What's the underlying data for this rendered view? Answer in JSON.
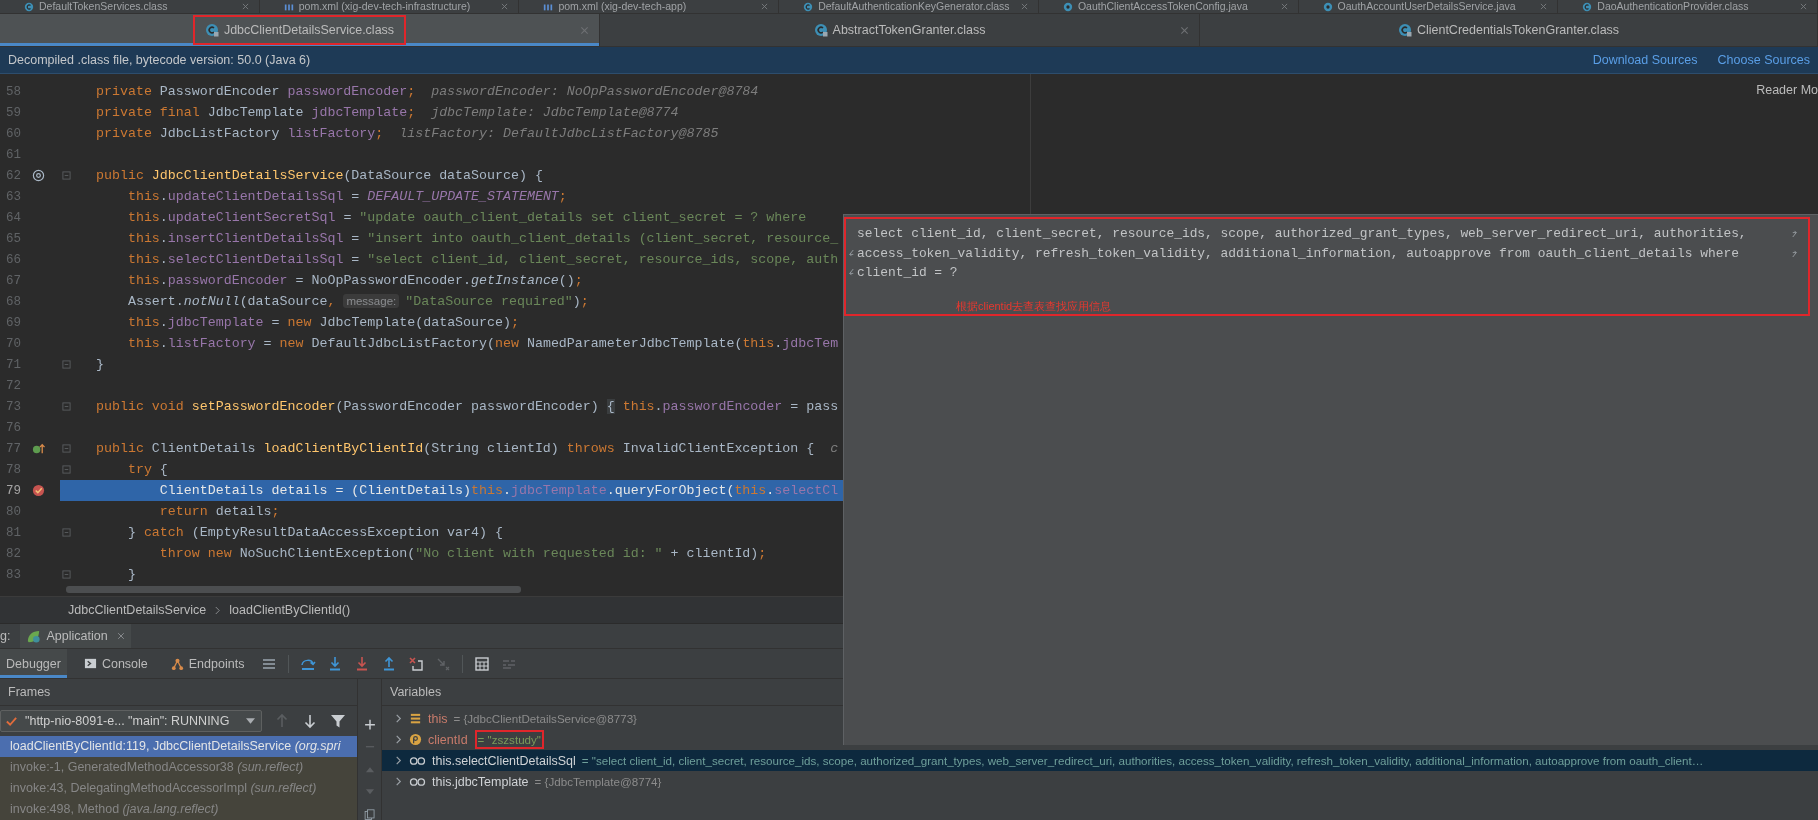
{
  "top_tabs": [
    {
      "label": "DefaultTokenServices.class",
      "kind": "class"
    },
    {
      "label": "pom.xml (xig-dev-tech-infrastructure)",
      "kind": "maven"
    },
    {
      "label": "pom.xml (xig-dev-tech-app)",
      "kind": "maven"
    },
    {
      "label": "DefaultAuthenticationKeyGenerator.class",
      "kind": "class"
    },
    {
      "label": "OauthClientAccessTokenConfig.java",
      "kind": "java"
    },
    {
      "label": "OauthAccountUserDetailsService.java",
      "kind": "java"
    },
    {
      "label": "DaoAuthenticationProvider.class",
      "kind": "class"
    }
  ],
  "editor_tabs": [
    {
      "label": "JdbcClientDetailsService.class",
      "kind": "class",
      "selected": true,
      "closable": true
    },
    {
      "label": "AbstractTokenGranter.class",
      "kind": "class",
      "selected": false,
      "closable": true
    },
    {
      "label": "ClientCredentialsTokenGranter.class",
      "kind": "class",
      "selected": false,
      "closable": false
    }
  ],
  "banner": {
    "message": "Decompiled .class file, bytecode version: 50.0 (Java 6)",
    "links": [
      "Download Sources",
      "Choose Sources"
    ]
  },
  "editor": {
    "reader_mode": "Reader Mo",
    "lines": [
      {
        "number": "58",
        "kind": "plain",
        "fold": false,
        "current": false,
        "tokens": [
          {
            "kind": "kw",
            "text": "private "
          },
          {
            "kind": "plain",
            "text": "PasswordEncoder "
          },
          {
            "kind": "field",
            "text": "passwordEncoder"
          },
          {
            "kind": "kw",
            "text": ";"
          },
          {
            "kind": "hint",
            "text": "  passwordEncoder: NoOpPasswordEncoder@8784"
          }
        ]
      },
      {
        "number": "59",
        "kind": "plain",
        "fold": false,
        "current": false,
        "tokens": [
          {
            "kind": "kw",
            "text": "private final "
          },
          {
            "kind": "plain",
            "text": "JdbcTemplate "
          },
          {
            "kind": "field",
            "text": "jdbcTemplate"
          },
          {
            "kind": "kw",
            "text": ";"
          },
          {
            "kind": "hint",
            "text": "  jdbcTemplate: JdbcTemplate@8774"
          }
        ]
      },
      {
        "number": "60",
        "kind": "plain",
        "fold": false,
        "current": false,
        "tokens": [
          {
            "kind": "kw",
            "text": "private "
          },
          {
            "kind": "plain",
            "text": "JdbcListFactory "
          },
          {
            "kind": "field",
            "text": "listFactory"
          },
          {
            "kind": "kw",
            "text": ";"
          },
          {
            "kind": "hint",
            "text": "  listFactory: DefaultJdbcListFactory@8785"
          }
        ]
      },
      {
        "number": "61",
        "kind": "plain",
        "fold": false,
        "current": false
      },
      {
        "number": "62",
        "kind": "at",
        "fold": true,
        "current": false,
        "tokens": [
          {
            "kind": "kw",
            "text": "public "
          },
          {
            "kind": "method",
            "text": "JdbcClientDetailsService"
          },
          {
            "kind": "plain",
            "text": "(DataSource dataSource) {"
          }
        ]
      },
      {
        "number": "63",
        "kind": "plain",
        "fold": false,
        "current": false,
        "tokens": [
          {
            "kind": "kw",
            "text": "    this"
          },
          {
            "kind": "plain",
            "text": "."
          },
          {
            "kind": "field",
            "text": "updateClientDetailsSql"
          },
          {
            "kind": "plain",
            "text": " = "
          },
          {
            "kind": "static",
            "text": "DEFAULT_UPDATE_STATEMENT"
          },
          {
            "kind": "kw",
            "text": ";"
          }
        ]
      },
      {
        "number": "64",
        "kind": "plain",
        "fold": false,
        "current": false,
        "tokens": [
          {
            "kind": "kw",
            "text": "    this"
          },
          {
            "kind": "plain",
            "text": "."
          },
          {
            "kind": "field",
            "text": "updateClientSecretSql"
          },
          {
            "kind": "plain",
            "text": " = "
          },
          {
            "kind": "str",
            "text": "\"update oauth_client_details set client_secret = ? where"
          }
        ]
      },
      {
        "number": "65",
        "kind": "plain",
        "fold": false,
        "current": false,
        "tokens": [
          {
            "kind": "kw",
            "text": "    this"
          },
          {
            "kind": "plain",
            "text": "."
          },
          {
            "kind": "field",
            "text": "insertClientDetailsSql"
          },
          {
            "kind": "plain",
            "text": " = "
          },
          {
            "kind": "str",
            "text": "\"insert into oauth_client_details (client_secret, resource_"
          }
        ]
      },
      {
        "number": "66",
        "kind": "plain",
        "fold": false,
        "current": false,
        "tokens": [
          {
            "kind": "kw",
            "text": "    this"
          },
          {
            "kind": "plain",
            "text": "."
          },
          {
            "kind": "field",
            "text": "selectClientDetailsSql"
          },
          {
            "kind": "plain",
            "text": " = "
          },
          {
            "kind": "str",
            "text": "\"select client_id, client_secret, resource_ids, scope, auth"
          }
        ]
      },
      {
        "number": "67",
        "kind": "plain",
        "fold": false,
        "current": false,
        "tokens": [
          {
            "kind": "kw",
            "text": "    this"
          },
          {
            "kind": "plain",
            "text": "."
          },
          {
            "kind": "field",
            "text": "passwordEncoder"
          },
          {
            "kind": "plain",
            "text": " = NoOpPasswordEncoder."
          },
          {
            "kind": "call",
            "text": "getInstance"
          },
          {
            "kind": "plain",
            "text": "()"
          },
          {
            "kind": "kw",
            "text": ";"
          }
        ]
      },
      {
        "number": "68",
        "kind": "plain",
        "fold": false,
        "current": false,
        "tokens": [
          {
            "kind": "plain",
            "text": "    Assert."
          },
          {
            "kind": "call",
            "text": "notNull"
          },
          {
            "kind": "plain",
            "text": "(dataSource"
          },
          {
            "kind": "kw",
            "text": ", "
          },
          {
            "kind": "inlay",
            "text": "message:"
          },
          {
            "kind": "str",
            "text": "\"DataSource required\""
          },
          {
            "kind": "plain",
            "text": ")"
          },
          {
            "kind": "kw",
            "text": ";"
          }
        ]
      },
      {
        "number": "69",
        "kind": "plain",
        "fold": false,
        "current": false,
        "tokens": [
          {
            "kind": "kw",
            "text": "    this"
          },
          {
            "kind": "plain",
            "text": "."
          },
          {
            "kind": "field",
            "text": "jdbcTemplate"
          },
          {
            "kind": "plain",
            "text": " = "
          },
          {
            "kind": "kw",
            "text": "new "
          },
          {
            "kind": "plain",
            "text": "JdbcTemplate(dataSource)"
          },
          {
            "kind": "kw",
            "text": ";"
          }
        ]
      },
      {
        "number": "70",
        "kind": "plain",
        "fold": false,
        "current": false,
        "tokens": [
          {
            "kind": "kw",
            "text": "    this"
          },
          {
            "kind": "plain",
            "text": "."
          },
          {
            "kind": "field",
            "text": "listFactory"
          },
          {
            "kind": "plain",
            "text": " = "
          },
          {
            "kind": "kw",
            "text": "new "
          },
          {
            "kind": "plain",
            "text": "DefaultJdbcListFactory("
          },
          {
            "kind": "kw",
            "text": "new "
          },
          {
            "kind": "plain",
            "text": "NamedParameterJdbcTemplate("
          },
          {
            "kind": "kw",
            "text": "this"
          },
          {
            "kind": "plain",
            "text": "."
          },
          {
            "kind": "field",
            "text": "jdbcTem"
          }
        ]
      },
      {
        "number": "71",
        "kind": "plain",
        "fold": true,
        "current": false,
        "tokens": [
          {
            "kind": "plain",
            "text": "}"
          }
        ]
      },
      {
        "number": "72",
        "kind": "plain",
        "fold": false,
        "current": false
      },
      {
        "number": "73",
        "kind": "plain",
        "fold": true,
        "current": false,
        "tokens": [
          {
            "kind": "kw",
            "text": "public void "
          },
          {
            "kind": "method",
            "text": "setPasswordEncoder"
          },
          {
            "kind": "plain",
            "text": "(PasswordEncoder passwordEncoder) "
          },
          {
            "kind": "folded",
            "text": "{"
          },
          {
            "kind": "kw",
            "text": " this"
          },
          {
            "kind": "plain",
            "text": "."
          },
          {
            "kind": "field",
            "text": "passwordEncoder"
          },
          {
            "kind": "plain",
            "text": " = pass"
          }
        ]
      },
      {
        "number": "76",
        "kind": "plain",
        "fold": false,
        "current": false
      },
      {
        "number": "77",
        "kind": "override",
        "fold": true,
        "current": false,
        "tokens": [
          {
            "kind": "kw",
            "text": "public "
          },
          {
            "kind": "plain",
            "text": "ClientDetails "
          },
          {
            "kind": "method",
            "text": "loadClientByClientId"
          },
          {
            "kind": "plain",
            "text": "(String clientId) "
          },
          {
            "kind": "kw",
            "text": "throws "
          },
          {
            "kind": "plain",
            "text": "InvalidClientException {  "
          },
          {
            "kind": "hint",
            "text": "c"
          }
        ]
      },
      {
        "number": "78",
        "kind": "plain",
        "fold": true,
        "current": false,
        "tokens": [
          {
            "kind": "kw",
            "text": "    try "
          },
          {
            "kind": "plain",
            "text": "{"
          }
        ]
      },
      {
        "number": "79",
        "kind": "breakpoint",
        "fold": false,
        "current": true,
        "tokens": [
          {
            "kind": "plain",
            "text": "        ClientDetails details = (ClientDetails)"
          },
          {
            "kind": "kw",
            "text": "this"
          },
          {
            "kind": "plain",
            "text": "."
          },
          {
            "kind": "field",
            "text": "jdbcTemplate"
          },
          {
            "kind": "plain",
            "text": ".queryForObject("
          },
          {
            "kind": "kw",
            "text": "this"
          },
          {
            "kind": "plain",
            "text": "."
          },
          {
            "kind": "field",
            "text": "selectCl"
          }
        ]
      },
      {
        "number": "80",
        "kind": "plain",
        "fold": false,
        "current": false,
        "tokens": [
          {
            "kind": "kw",
            "text": "        return "
          },
          {
            "kind": "plain",
            "text": "details"
          },
          {
            "kind": "kw",
            "text": ";"
          }
        ]
      },
      {
        "number": "81",
        "kind": "plain",
        "fold": true,
        "current": false,
        "tokens": [
          {
            "kind": "plain",
            "text": "    } "
          },
          {
            "kind": "kw",
            "text": "catch "
          },
          {
            "kind": "plain",
            "text": "(EmptyResultDataAccessException var4) {"
          }
        ]
      },
      {
        "number": "82",
        "kind": "plain",
        "fold": false,
        "current": false,
        "tokens": [
          {
            "kind": "kw",
            "text": "        throw new "
          },
          {
            "kind": "plain",
            "text": "NoSuchClientException("
          },
          {
            "kind": "str",
            "text": "\"No client with requested id: \""
          },
          {
            "kind": "plain",
            "text": " + clientId)"
          },
          {
            "kind": "kw",
            "text": ";"
          }
        ]
      },
      {
        "number": "83",
        "kind": "plain",
        "fold": true,
        "current": false,
        "tokens": [
          {
            "kind": "plain",
            "text": "    }"
          }
        ]
      }
    ]
  },
  "popup": {
    "sql_lines": [
      {
        "text": "select client_id, client_secret, resource_ids, scope, authorized_grant_types, web_server_redirect_uri, authorities,",
        "wrap_before": false,
        "wrap_after": true
      },
      {
        "text": "access_token_validity, refresh_token_validity, additional_information, autoapprove from oauth_client_details where",
        "wrap_before": true,
        "wrap_after": true
      },
      {
        "text": "client_id = ?",
        "wrap_before": true,
        "wrap_after": false
      }
    ],
    "note": "根据clientid去查表查找应用信息"
  },
  "breadcrumb": [
    "JdbcClientDetailsService",
    "loadClientByClientId()"
  ],
  "debug": {
    "label": "g:",
    "session": "Application",
    "tabs": [
      {
        "label": "Debugger",
        "kind": "plain",
        "selected": true
      },
      {
        "label": "Console",
        "kind": "terminal",
        "selected": false
      },
      {
        "label": "Endpoints",
        "kind": "nodes",
        "selected": false
      }
    ],
    "frames_title": "Frames",
    "thread": "\"http-nio-8091-e... \"main\": RUNNING",
    "frames": [
      {
        "method": "loadClientByClientId:119, JdbcClientDetailsService",
        "package": "(org.spri",
        "selected": true
      },
      {
        "method": "invoke:-1, GeneratedMethodAccessor38",
        "package": "(sun.reflect)",
        "selected": false
      },
      {
        "method": "invoke:43, DelegatingMethodAccessorImpl",
        "package": "(sun.reflect)",
        "selected": false
      },
      {
        "method": "invoke:498, Method",
        "package": "(java.lang.reflect)",
        "selected": false
      }
    ],
    "variables_title": "Variables",
    "variables": [
      {
        "kind": "fields",
        "name": "this",
        "value": "= {JdbcClientDetailsService@8773}",
        "expanded": false,
        "selected": false
      },
      {
        "kind": "param",
        "name": "clientId",
        "string_value": "= \"zszstudy\"",
        "expanded": false,
        "selected": false
      },
      {
        "kind": "watch",
        "name": "this.selectClientDetailsSql",
        "string_value": "= \"select client_id, client_secret, resource_ids, scope, authorized_grant_types, web_server_redirect_uri, authorities, access_token_validity, refresh_token_validity, additional_information, autoapprove from oauth_client…",
        "expanded": false,
        "selected": true
      },
      {
        "kind": "watch",
        "name": "this.jdbcTemplate",
        "value": "= {JdbcTemplate@8774}",
        "expanded": false,
        "selected": false
      }
    ]
  }
}
